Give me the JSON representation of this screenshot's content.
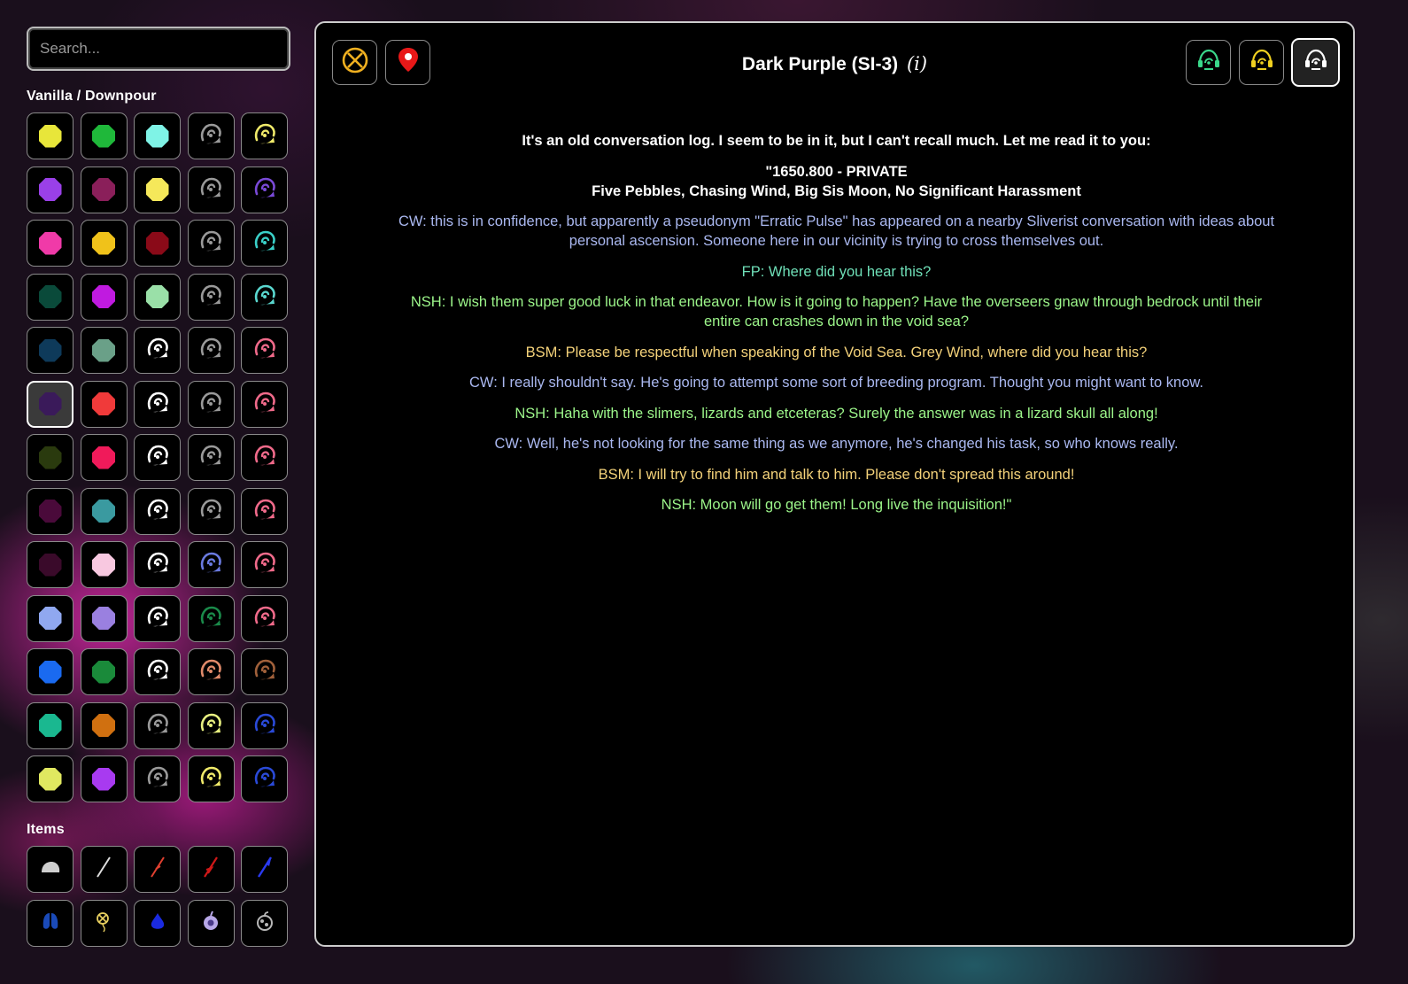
{
  "search": {
    "placeholder": "Search..."
  },
  "sidebar": {
    "vanilla_title": "Vanilla / Downpour",
    "items_title": "Items",
    "selected_index": 25,
    "tiles": [
      {
        "kind": "pearl",
        "color": "#e8e63a"
      },
      {
        "kind": "pearl",
        "color": "#1fb83a"
      },
      {
        "kind": "pearl",
        "color": "#7ff3e6"
      },
      {
        "kind": "scav",
        "color": "#9a9a9a"
      },
      {
        "kind": "scav",
        "color": "#f0ea6a"
      },
      {
        "kind": "pearl",
        "color": "#9a40e8"
      },
      {
        "kind": "pearl",
        "color": "#8a1f5a"
      },
      {
        "kind": "pearl",
        "color": "#f5e85a"
      },
      {
        "kind": "scav",
        "color": "#9a9a9a"
      },
      {
        "kind": "scav",
        "color": "#7a4ad8"
      },
      {
        "kind": "pearl",
        "color": "#f03aa8"
      },
      {
        "kind": "pearl",
        "color": "#f0c21a"
      },
      {
        "kind": "pearl",
        "color": "#8a0a18"
      },
      {
        "kind": "scav",
        "color": "#9a9a9a"
      },
      {
        "kind": "scav",
        "color": "#3ad0c8"
      },
      {
        "kind": "pearl",
        "color": "#0a4a3a"
      },
      {
        "kind": "pearl",
        "color": "#c01ae0"
      },
      {
        "kind": "pearl",
        "color": "#9ae0a8"
      },
      {
        "kind": "scav",
        "color": "#9a9a9a"
      },
      {
        "kind": "scav",
        "color": "#5ad8d0"
      },
      {
        "kind": "pearl",
        "color": "#0e3a5a"
      },
      {
        "kind": "pearl",
        "color": "#6aa088"
      },
      {
        "kind": "scav",
        "color": "#ffffff"
      },
      {
        "kind": "scav",
        "color": "#9a9a9a"
      },
      {
        "kind": "scav",
        "color": "#f06a8a"
      },
      {
        "kind": "pearl",
        "color": "#3a1a5a"
      },
      {
        "kind": "pearl",
        "color": "#f03a3a"
      },
      {
        "kind": "scav",
        "color": "#ffffff"
      },
      {
        "kind": "scav",
        "color": "#9a9a9a"
      },
      {
        "kind": "scav",
        "color": "#f06a8a"
      },
      {
        "kind": "pearl",
        "color": "#2a3a0e"
      },
      {
        "kind": "pearl",
        "color": "#f01a5a"
      },
      {
        "kind": "scav",
        "color": "#ffffff"
      },
      {
        "kind": "scav",
        "color": "#9a9a9a"
      },
      {
        "kind": "scav",
        "color": "#f06a8a"
      },
      {
        "kind": "pearl",
        "color": "#4a0a3a"
      },
      {
        "kind": "pearl",
        "color": "#3a9aa0"
      },
      {
        "kind": "scav",
        "color": "#ffffff"
      },
      {
        "kind": "scav",
        "color": "#9a9a9a"
      },
      {
        "kind": "scav",
        "color": "#f06a8a"
      },
      {
        "kind": "pearl",
        "color": "#3a0a2a"
      },
      {
        "kind": "pearl",
        "color": "#f8c8e0"
      },
      {
        "kind": "scav",
        "color": "#ffffff"
      },
      {
        "kind": "scav",
        "color": "#6a7ae0"
      },
      {
        "kind": "scav",
        "color": "#f06a8a"
      },
      {
        "kind": "pearl",
        "color": "#90a8f0"
      },
      {
        "kind": "pearl",
        "color": "#9a80e0"
      },
      {
        "kind": "scav",
        "color": "#ffffff"
      },
      {
        "kind": "scav",
        "color": "#1a8a4a"
      },
      {
        "kind": "scav",
        "color": "#f06a8a"
      },
      {
        "kind": "pearl",
        "color": "#1a6af0"
      },
      {
        "kind": "pearl",
        "color": "#1a8a3a"
      },
      {
        "kind": "scav",
        "color": "#ffffff"
      },
      {
        "kind": "scav",
        "color": "#e08a6a"
      },
      {
        "kind": "scav",
        "color": "#a0603a"
      },
      {
        "kind": "pearl",
        "color": "#1ab890"
      },
      {
        "kind": "pearl",
        "color": "#d07010"
      },
      {
        "kind": "scav",
        "color": "#9a9a9a"
      },
      {
        "kind": "scav",
        "color": "#e8f080"
      },
      {
        "kind": "scav",
        "color": "#2a4ad8"
      },
      {
        "kind": "pearl",
        "color": "#e0e860"
      },
      {
        "kind": "pearl",
        "color": "#a83af0"
      },
      {
        "kind": "scav",
        "color": "#9a9a9a"
      },
      {
        "kind": "scav",
        "color": "#f0ea6a"
      },
      {
        "kind": "scav",
        "color": "#2a4ad8"
      }
    ],
    "items": [
      {
        "icon": "rock-icon",
        "color": "#cfcfcf"
      },
      {
        "icon": "spear-icon",
        "color": "#dddddd"
      },
      {
        "icon": "explosive-spear-icon",
        "color": "#e04030"
      },
      {
        "icon": "fire-spear-icon",
        "color": "#d01818"
      },
      {
        "icon": "electric-spear-icon",
        "color": "#2a3af0"
      },
      {
        "icon": "lungs-icon",
        "color": "#1a4ab8"
      },
      {
        "icon": "iterator-symbol-icon",
        "color": "#e8d060"
      },
      {
        "icon": "droplet-icon",
        "color": "#1a2ae0"
      },
      {
        "icon": "neuron-icon",
        "color": "#b8a8e8"
      },
      {
        "icon": "bubble-fruit-icon",
        "color": "#b8b8b8"
      }
    ]
  },
  "header": {
    "title": "Dark Purple (SI-3)",
    "info": "(𝑖)",
    "left_buttons": [
      {
        "icon": "iterator-symbol-icon",
        "color": "#f0b020"
      },
      {
        "icon": "map-pin-icon",
        "color": "#e81818"
      }
    ],
    "right_buttons": [
      {
        "icon": "scavenger-green-icon",
        "color": "#3ad88a"
      },
      {
        "icon": "scavenger-yellow-icon",
        "color": "#f0d020"
      },
      {
        "icon": "scavenger-white-icon",
        "color": "#ffffff"
      }
    ]
  },
  "dialogue": [
    {
      "text": "It's an old conversation log. I seem to be in it, but I can't recall much. Let me read it to you:",
      "style": "white"
    },
    {
      "text": "\"1650.800 - PRIVATE",
      "style": "white",
      "tight": true
    },
    {
      "text": "Five Pebbles, Chasing Wind, Big Sis Moon, No Significant Harassment",
      "style": "white"
    },
    {
      "text": "CW: this is in confidence, but apparently a pseudonym \"Erratic Pulse\" has appeared on a nearby Sliverist conversation with ideas about personal ascension. Someone here in our vicinity is trying to cross themselves out.",
      "style": "cw"
    },
    {
      "text": "FP: Where did you hear this?",
      "style": "fp"
    },
    {
      "text": "NSH: I wish them super good luck in that endeavor. How is it going to happen? Have the overseers gnaw through bedrock until their entire can crashes down in the void sea?",
      "style": "nsh"
    },
    {
      "text": "BSM: Please be respectful when speaking of the Void Sea. Grey Wind, where did you hear this?",
      "style": "bsm"
    },
    {
      "text": "CW: I really shouldn't say. He's going to attempt some sort of breeding program. Thought you might want to know.",
      "style": "cw"
    },
    {
      "text": "NSH: Haha with the slimers, lizards and etceteras? Surely the answer was in a lizard skull all along!",
      "style": "nsh"
    },
    {
      "text": "CW: Well, he's not looking for the same thing as we anymore, he's changed his task, so who knows really.",
      "style": "cw"
    },
    {
      "text": "BSM: I will try to find him and talk to him. Please don't spread this around!",
      "style": "bsm"
    },
    {
      "text": "NSH: Moon will go get them! Long live the inquisition!\"",
      "style": "nsh"
    }
  ]
}
